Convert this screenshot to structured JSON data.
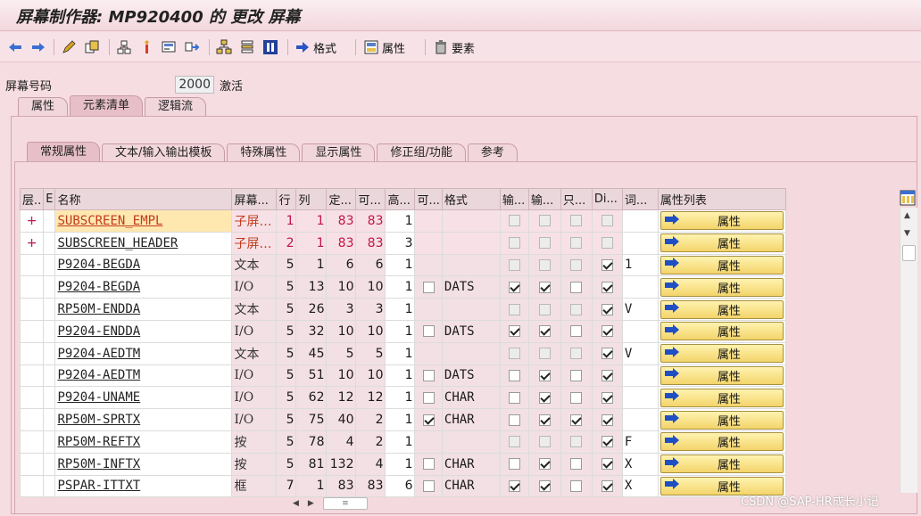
{
  "window": {
    "title": "屏幕制作器: MP920400 的 更改 屏幕"
  },
  "toolbar": {
    "items": [
      {
        "name": "back-icon"
      },
      {
        "name": "forward-icon"
      },
      {
        "name": "edit-icon"
      },
      {
        "name": "copy-object-icon"
      },
      {
        "name": "hierarchy-icon"
      },
      {
        "name": "info-marker-icon"
      },
      {
        "name": "layout-icon"
      },
      {
        "name": "navigate-icon"
      },
      {
        "name": "tree-icon"
      },
      {
        "name": "stack-icon"
      },
      {
        "name": "details-icon"
      }
    ],
    "format_label": "格式",
    "attributes_label": "属性",
    "elements_label": "要素"
  },
  "screen": {
    "number_label": "屏幕号码",
    "number_value": "2000",
    "status": "激活"
  },
  "top_tabs": [
    "属性",
    "元素清单",
    "逻辑流"
  ],
  "sub_tabs": [
    "常规属性",
    "文本/输入输出模板",
    "特殊属性",
    "显示属性",
    "修正组/功能",
    "参考"
  ],
  "grid": {
    "headers": [
      "层..",
      "E",
      "名称",
      "屏幕...",
      "行",
      "列",
      "定...",
      "可...",
      "高...",
      "可...",
      "格式",
      "输...",
      "输...",
      "只...",
      "Di...",
      "词...",
      "属性列表"
    ],
    "attr_button_label": "属性",
    "rows": [
      {
        "marker": "+",
        "name": "SUBSCREEN_EMPL",
        "type": "子屏…",
        "line": "1",
        "col": "1",
        "deflen": "83",
        "vislen": "83",
        "height": "1",
        "scroll": "",
        "format": "",
        "input": "",
        "output": "",
        "readonly": "",
        "dict": "",
        "word": ""
      },
      {
        "marker": "+",
        "name": "SUBSCREEN_HEADER",
        "type": "子屏…",
        "line": "2",
        "col": "1",
        "deflen": "83",
        "vislen": "83",
        "height": "3",
        "scroll": "",
        "format": "",
        "input": "",
        "output": "",
        "readonly": "",
        "dict": "",
        "word": ""
      },
      {
        "marker": "",
        "name": "P9204-BEGDA",
        "type": "文本",
        "line": "5",
        "col": "1",
        "deflen": "6",
        "vislen": "6",
        "height": "1",
        "scroll": "",
        "format": "",
        "input": "",
        "output": "",
        "readonly": "",
        "dict": "✓",
        "word": "1"
      },
      {
        "marker": "",
        "name": "P9204-BEGDA",
        "type": "I/O",
        "line": "5",
        "col": "13",
        "deflen": "10",
        "vislen": "10",
        "height": "1",
        "scroll": "",
        "format": "DATS",
        "input": "✓",
        "output": "✓",
        "readonly": "",
        "dict": "✓",
        "word": ""
      },
      {
        "marker": "",
        "name": "RP50M-ENDDA",
        "type": "文本",
        "line": "5",
        "col": "26",
        "deflen": "3",
        "vislen": "3",
        "height": "1",
        "scroll": "",
        "format": "",
        "input": "",
        "output": "",
        "readonly": "",
        "dict": "✓",
        "word": "V"
      },
      {
        "marker": "",
        "name": "P9204-ENDDA",
        "type": "I/O",
        "line": "5",
        "col": "32",
        "deflen": "10",
        "vislen": "10",
        "height": "1",
        "scroll": "",
        "format": "DATS",
        "input": "✓",
        "output": "✓",
        "readonly": "",
        "dict": "✓",
        "word": ""
      },
      {
        "marker": "",
        "name": "P9204-AEDTM",
        "type": "文本",
        "line": "5",
        "col": "45",
        "deflen": "5",
        "vislen": "5",
        "height": "1",
        "scroll": "",
        "format": "",
        "input": "",
        "output": "",
        "readonly": "",
        "dict": "✓",
        "word": "V"
      },
      {
        "marker": "",
        "name": "P9204-AEDTM",
        "type": "I/O",
        "line": "5",
        "col": "51",
        "deflen": "10",
        "vislen": "10",
        "height": "1",
        "scroll": "",
        "format": "DATS",
        "input": "",
        "output": "✓",
        "readonly": "",
        "dict": "✓",
        "word": ""
      },
      {
        "marker": "",
        "name": "P9204-UNAME",
        "type": "I/O",
        "line": "5",
        "col": "62",
        "deflen": "12",
        "vislen": "12",
        "height": "1",
        "scroll": "",
        "format": "CHAR",
        "input": "",
        "output": "✓",
        "readonly": "",
        "dict": "✓",
        "word": ""
      },
      {
        "marker": "",
        "name": "RP50M-SPRTX",
        "type": "I/O",
        "line": "5",
        "col": "75",
        "deflen": "40",
        "vislen": "2",
        "height": "1",
        "scroll": "✓",
        "format": "CHAR",
        "input": "",
        "output": "✓",
        "readonly": "✓",
        "dict": "✓",
        "word": ""
      },
      {
        "marker": "",
        "name": "RP50M-REFTX",
        "type": "按",
        "line": "5",
        "col": "78",
        "deflen": "4",
        "vislen": "2",
        "height": "1",
        "scroll": "",
        "format": "",
        "input": "",
        "output": "",
        "readonly": "",
        "dict": "✓",
        "word": "F"
      },
      {
        "marker": "",
        "name": "RP50M-INFTX",
        "type": "按",
        "line": "5",
        "col": "81",
        "deflen": "132",
        "vislen": "4",
        "height": "1",
        "scroll": "",
        "format": "CHAR",
        "input": "",
        "output": "✓",
        "readonly": "",
        "dict": "✓",
        "word": "X"
      },
      {
        "marker": "",
        "name": "PSPAR-ITTXT",
        "type": "框",
        "line": "7",
        "col": "1",
        "deflen": "83",
        "vislen": "83",
        "height": "6",
        "scroll": "",
        "format": "CHAR",
        "input": "✓",
        "output": "✓",
        "readonly": "",
        "dict": "✓",
        "word": "X"
      }
    ]
  },
  "watermark": "CSDN @SAP-HR成长小记",
  "colors": {
    "background": "#f6dde2",
    "attr_button": "#f3d46a",
    "highlight_red": "#c2144a"
  }
}
